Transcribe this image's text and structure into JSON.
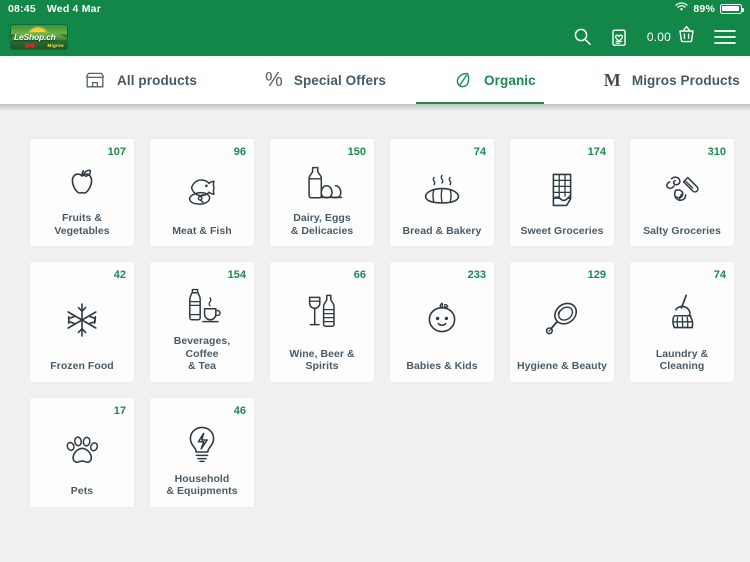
{
  "statusbar": {
    "time": "08:45",
    "date": "Wed 4 Mar",
    "battery_percent": "89%",
    "wifi_icon": "wifi-icon",
    "battery_icon": "battery-icon"
  },
  "header": {
    "logo_text": "LeShop.ch",
    "logo_sub": "Migros",
    "cart_amount": "0.00",
    "search_icon": "search-icon",
    "shopping_list_icon": "shopping-list-heart-icon",
    "basket_icon": "basket-icon",
    "menu_icon": "hamburger-menu-icon",
    "background_color": "#128748"
  },
  "tabs": [
    {
      "label": "All products",
      "icon": "store-icon",
      "active": false
    },
    {
      "label": "Special Offers",
      "icon": "percent-icon",
      "active": false
    },
    {
      "label": "Organic",
      "icon": "leaf-icon",
      "active": true
    },
    {
      "label": "Migros Products",
      "icon": "migros-m-icon",
      "active": false
    }
  ],
  "accent_color": "#1a8a4f",
  "categories": [
    {
      "name": "Fruits & Vegetables",
      "count": "107",
      "icon": "apple-icon"
    },
    {
      "name": "Meat & Fish",
      "count": "96",
      "icon": "fish-steak-icon"
    },
    {
      "name": "Dairy, Eggs\n& Delicacies",
      "count": "150",
      "icon": "milk-bottle-eggs-icon"
    },
    {
      "name": "Bread & Bakery",
      "count": "74",
      "icon": "bread-loaf-icon"
    },
    {
      "name": "Sweet Groceries",
      "count": "174",
      "icon": "chocolate-bar-icon"
    },
    {
      "name": "Salty Groceries",
      "count": "310",
      "icon": "pasta-icon"
    },
    {
      "name": "Frozen Food",
      "count": "42",
      "icon": "snowflake-icon"
    },
    {
      "name": "Beverages, Coffee\n& Tea",
      "count": "154",
      "icon": "bottle-coffee-cup-icon"
    },
    {
      "name": "Wine, Beer & Spirits",
      "count": "66",
      "icon": "wine-glass-bottle-icon"
    },
    {
      "name": "Babies & Kids",
      "count": "233",
      "icon": "baby-face-icon"
    },
    {
      "name": "Hygiene & Beauty",
      "count": "129",
      "icon": "hand-mirror-icon"
    },
    {
      "name": "Laundry & Cleaning",
      "count": "74",
      "icon": "broom-icon"
    },
    {
      "name": "Pets",
      "count": "17",
      "icon": "paw-print-icon"
    },
    {
      "name": "Household\n& Equipments",
      "count": "46",
      "icon": "lightbulb-icon"
    }
  ]
}
